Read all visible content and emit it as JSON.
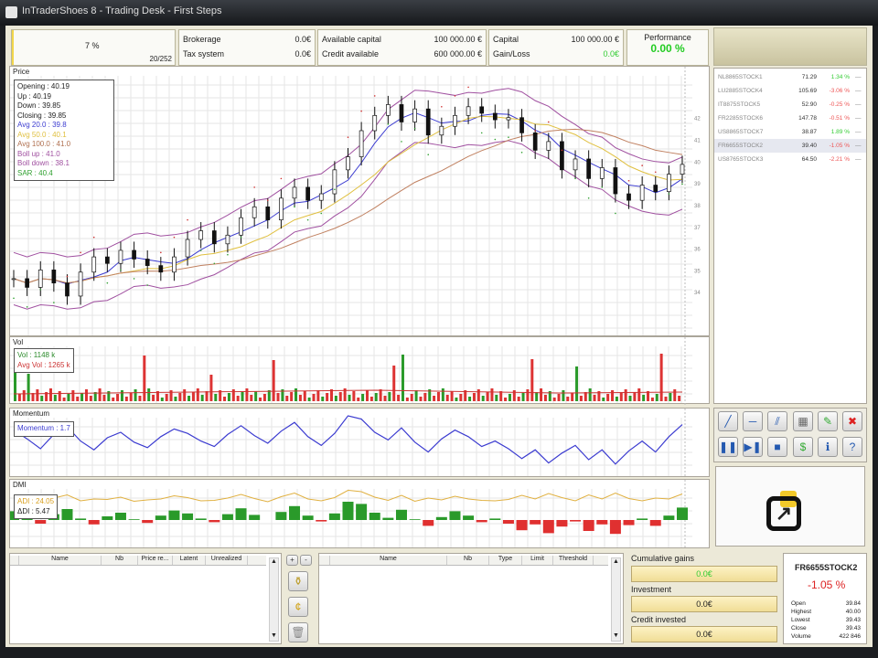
{
  "window": {
    "title": "InTraderShoes 8 - Trading Desk - First Steps"
  },
  "header": {
    "progress_pct": "7 %",
    "progress_value": 7,
    "days": "20/252",
    "brokerage_label": "Brokerage",
    "brokerage": "0.0€",
    "tax_label": "Tax system",
    "tax": "0.0€",
    "avail_label": "Available capital",
    "avail": "100 000.00 €",
    "credit_label": "Credit available",
    "credit": "600 000.00 €",
    "capital_label": "Capital",
    "capital": "100 000.00 €",
    "gain_label": "Gain/Loss",
    "gain": "0.0€",
    "perf_label": "Performance",
    "perf": "0.00 %"
  },
  "price_panel": {
    "title": "Price",
    "legend": [
      "Opening : 40.19",
      "Up : 40.19",
      "Down : 39.85",
      "Closing : 39.85",
      "Avg 20.0 : 39.8",
      "Avg 50.0 : 40.1",
      "Avg 100.0 : 41.0",
      "Boll up : 41.0",
      "Boll down : 38.1",
      "SAR : 40.4"
    ],
    "legend_colors": [
      "#222",
      "#222",
      "#222",
      "#222",
      "#3b3bd0",
      "#e0c040",
      "#b07050",
      "#a050a0",
      "#a050a0",
      "#30a030"
    ]
  },
  "vol_panel": {
    "title": "Vol",
    "legend": [
      "Vol : 1148 k",
      "Avg Vol : 1265 k"
    ]
  },
  "mom_panel": {
    "title": "Momentum",
    "legend": [
      "Momentum : 1.7"
    ]
  },
  "dmi_panel": {
    "title": "DMI",
    "legend": [
      "ADI : 24.05",
      "ΔDI : 5.47"
    ]
  },
  "chart_data": {
    "type": "line",
    "closes": [
      34.6,
      34.2,
      35.0,
      34.4,
      33.8,
      34.9,
      35.6,
      35.3,
      35.9,
      35.5,
      35.2,
      34.9,
      35.6,
      36.4,
      36.8,
      36.2,
      36.6,
      37.4,
      37.9,
      37.3,
      38.3,
      38.8,
      38.2,
      38.5,
      39.6,
      40.2,
      41.4,
      42.1,
      42.6,
      41.8,
      42.4,
      41.2,
      41.6,
      42.1,
      42.5,
      42.2,
      41.9,
      42.0,
      41.3,
      40.5,
      40.9,
      39.6,
      40.1,
      39.2,
      39.7,
      38.5,
      38.2,
      38.9,
      38.6,
      39.4,
      39.85
    ],
    "momentum": [
      1.2,
      0.4,
      -0.5,
      0.8,
      1.5,
      0.2,
      -0.6,
      0.5,
      1.0,
      0.1,
      -0.4,
      0.6,
      1.3,
      0.9,
      0.2,
      -0.3,
      0.8,
      1.6,
      0.7,
      0.0,
      1.1,
      1.9,
      0.6,
      -0.2,
      0.9,
      2.5,
      2.2,
      1.0,
      0.3,
      1.4,
      0.1,
      -0.8,
      0.4,
      1.2,
      0.6,
      -0.3,
      0.2,
      -0.5,
      -1.4,
      -0.6,
      -1.8,
      -0.9,
      -0.2,
      -1.5,
      -0.6,
      -1.9,
      -0.7,
      0.2,
      -0.8,
      0.6,
      1.7
    ]
  },
  "watchlist": [
    {
      "name": "NL8865STOCK1",
      "price": "71.29",
      "change": "1.34 %",
      "up": true
    },
    {
      "name": "LU2885STOCK4",
      "price": "105.69",
      "change": "-3.06 %",
      "up": false
    },
    {
      "name": "IT8875STOCK5",
      "price": "52.90",
      "change": "-0.25 %",
      "up": false
    },
    {
      "name": "FR2285STOCK6",
      "price": "147.78",
      "change": "-0.51 %",
      "up": false
    },
    {
      "name": "US8865STOCK7",
      "price": "38.87",
      "change": "1.89 %",
      "up": true
    },
    {
      "name": "FR6655STOCK2",
      "price": "39.40",
      "change": "-1.05 %",
      "up": false
    },
    {
      "name": "US8765STOCK3",
      "price": "64.50",
      "change": "-2.21 %",
      "up": false
    }
  ],
  "portfolio": {
    "headers": [
      "Name",
      "Nb",
      "Price re...",
      "Latent",
      "Unrealized"
    ]
  },
  "orders": {
    "headers": [
      "Name",
      "Nb",
      "Type",
      "Limit",
      "Threshold"
    ]
  },
  "summary": {
    "cum_label": "Cumulative gains",
    "cum": "0.0€",
    "inv_label": "Investment",
    "inv": "0.0€",
    "credit_label": "Credit invested",
    "credit": "0.0€"
  },
  "quote": {
    "name": "FR6655STOCK2",
    "change": "-1.05 %",
    "rows": [
      [
        "Open",
        "39.84"
      ],
      [
        "Highest",
        "40.00"
      ],
      [
        "Lowest",
        "39.43"
      ],
      [
        "Close",
        "39.43"
      ],
      [
        "Volume",
        "422 846"
      ]
    ]
  }
}
